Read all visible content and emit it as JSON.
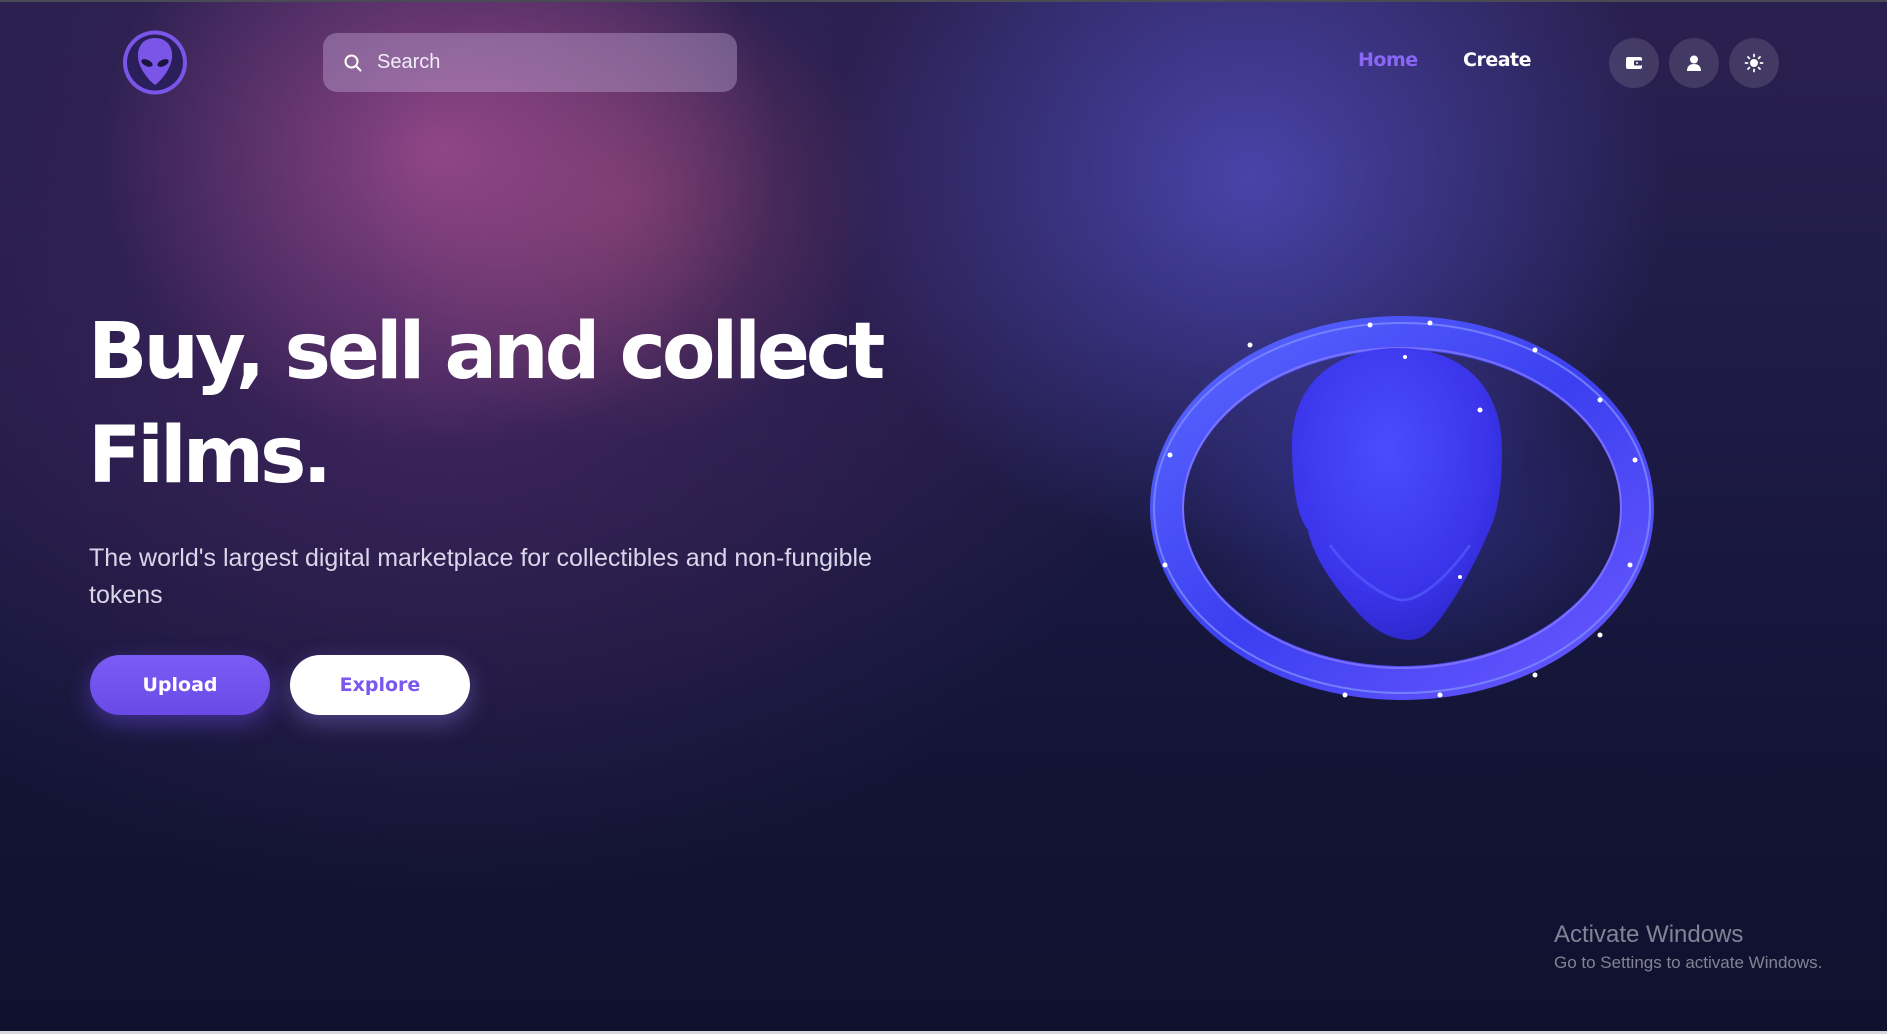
{
  "header": {
    "logo_icon": "alien-head-icon",
    "search": {
      "placeholder": "Search",
      "icon": "search-icon"
    },
    "nav": {
      "home_label": "Home",
      "create_label": "Create"
    },
    "actions": [
      {
        "icon": "wallet-icon"
      },
      {
        "icon": "user-icon"
      },
      {
        "icon": "sun-icon"
      }
    ]
  },
  "hero": {
    "title_line1": "Buy, sell and collect",
    "title_line2": "Films.",
    "subtitle": "The world's largest digital marketplace for collectibles and non-fungible tokens",
    "upload_label": "Upload",
    "explore_label": "Explore",
    "art_icon": "alien-head-3d-icon"
  },
  "watermark": {
    "title": "Activate Windows",
    "subtitle": "Go to Settings to activate Windows."
  },
  "colors": {
    "accent": "#7b5cf5",
    "nav_active": "#8a66f5",
    "background": "#121330",
    "art_blue": "#3c3cf0"
  }
}
